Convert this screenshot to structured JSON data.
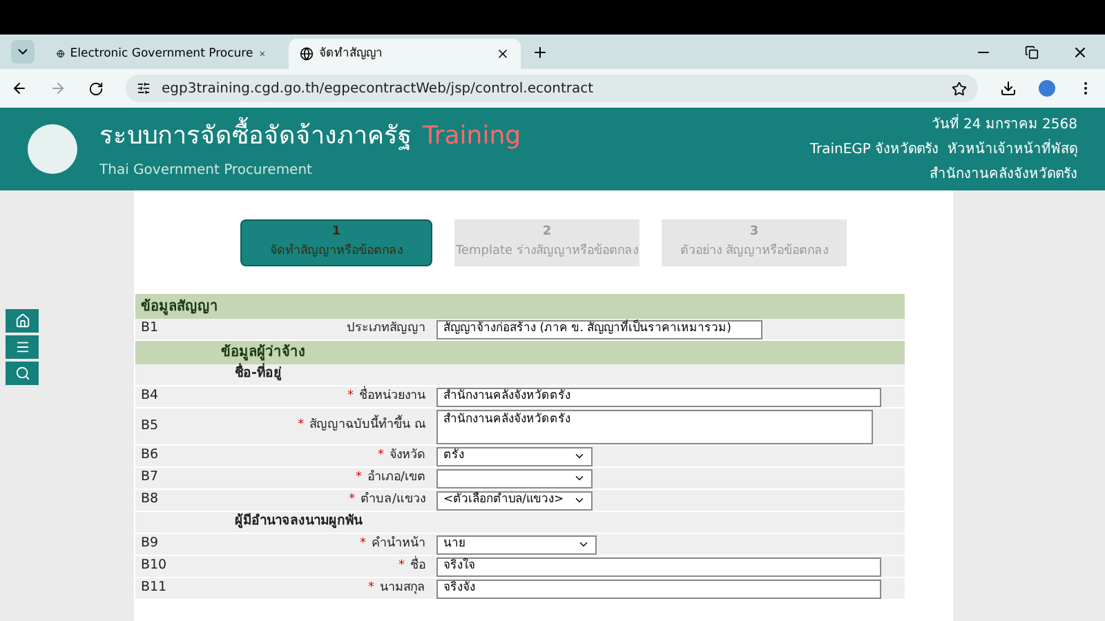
{
  "browser": {
    "tabs": [
      {
        "title": "Electronic Government Procure",
        "selected": false
      },
      {
        "title": "จัดทำสัญญา",
        "selected": true
      }
    ],
    "url": "egp3training.cgd.go.th/egpecontractWeb/jsp/control.econtract"
  },
  "header": {
    "title": "ระบบการจัดซื้อจัดจ้างภาครัฐ",
    "badge": "Training",
    "subtitle": "Thai Government Procurement",
    "date": "วันที่ 24 มกราคม 2568",
    "user": "TrainEGP จังหวัดตรัง  หัวหน้าเจ้าหน้าที่พัสดุ",
    "office": "สำนักงานคลังจังหวัดตรัง"
  },
  "steps": [
    {
      "number": "1",
      "label": "จัดทำสัญญาหรือข้อตกลง",
      "selected": true
    },
    {
      "number": "2",
      "label": "Template ร่างสัญญาหรือข้อตกลง",
      "selected": false
    },
    {
      "number": "3",
      "label": "ตัวอย่าง สัญญาหรือข้อตกลง",
      "selected": false
    }
  ],
  "form": [
    {
      "kind": "section",
      "label": "ข้อมูลสัญญา"
    },
    {
      "kind": "readonly",
      "code": "B1",
      "label": "ประเภทสัญญา",
      "value": "สัญญาจ้างก่อสร้าง (ภาค ข. สัญญาที่เป็นราคาเหมารวม)"
    },
    {
      "kind": "subsection",
      "label": "ข้อมูลผู้ว่าจ้าง"
    },
    {
      "kind": "group",
      "label": "ชื่อ-ที่อยู่"
    },
    {
      "kind": "text",
      "code": "B4",
      "label": "ชื่อหน่วยงาน",
      "mark": "*",
      "value": "สำนักงานคลังจังหวัดตรัง"
    },
    {
      "kind": "textarea",
      "code": "B5",
      "label": "สัญญาฉบับนี้ทำขึ้น ณ",
      "mark": "*",
      "value": "สำนักงานคลังจังหวัดตรัง"
    },
    {
      "kind": "select",
      "code": "B6",
      "label": "จังหวัด",
      "mark": "*",
      "value": "ตรัง"
    },
    {
      "kind": "select",
      "code": "B7",
      "label": "อำเภอ/เขต",
      "mark": "*"
    },
    {
      "kind": "select",
      "code": "B8",
      "label": "ตำบล/แขวง",
      "mark": "*",
      "value": "<ตัวเลือกตำบล/แขวง>"
    },
    {
      "kind": "group",
      "label": "ผู้มีอำนาจลงนามผูกพัน"
    },
    {
      "kind": "select",
      "code": "B9",
      "label": "คำนำหน้า",
      "mark": "*",
      "value": "นาย"
    },
    {
      "kind": "text",
      "code": "B10",
      "label": "ชื่อ",
      "mark": "*",
      "value": "จริงใจ"
    },
    {
      "kind": "text",
      "code": "B11",
      "label": "นามสกุล",
      "mark": "*",
      "value": "จริงจัง"
    }
  ]
}
